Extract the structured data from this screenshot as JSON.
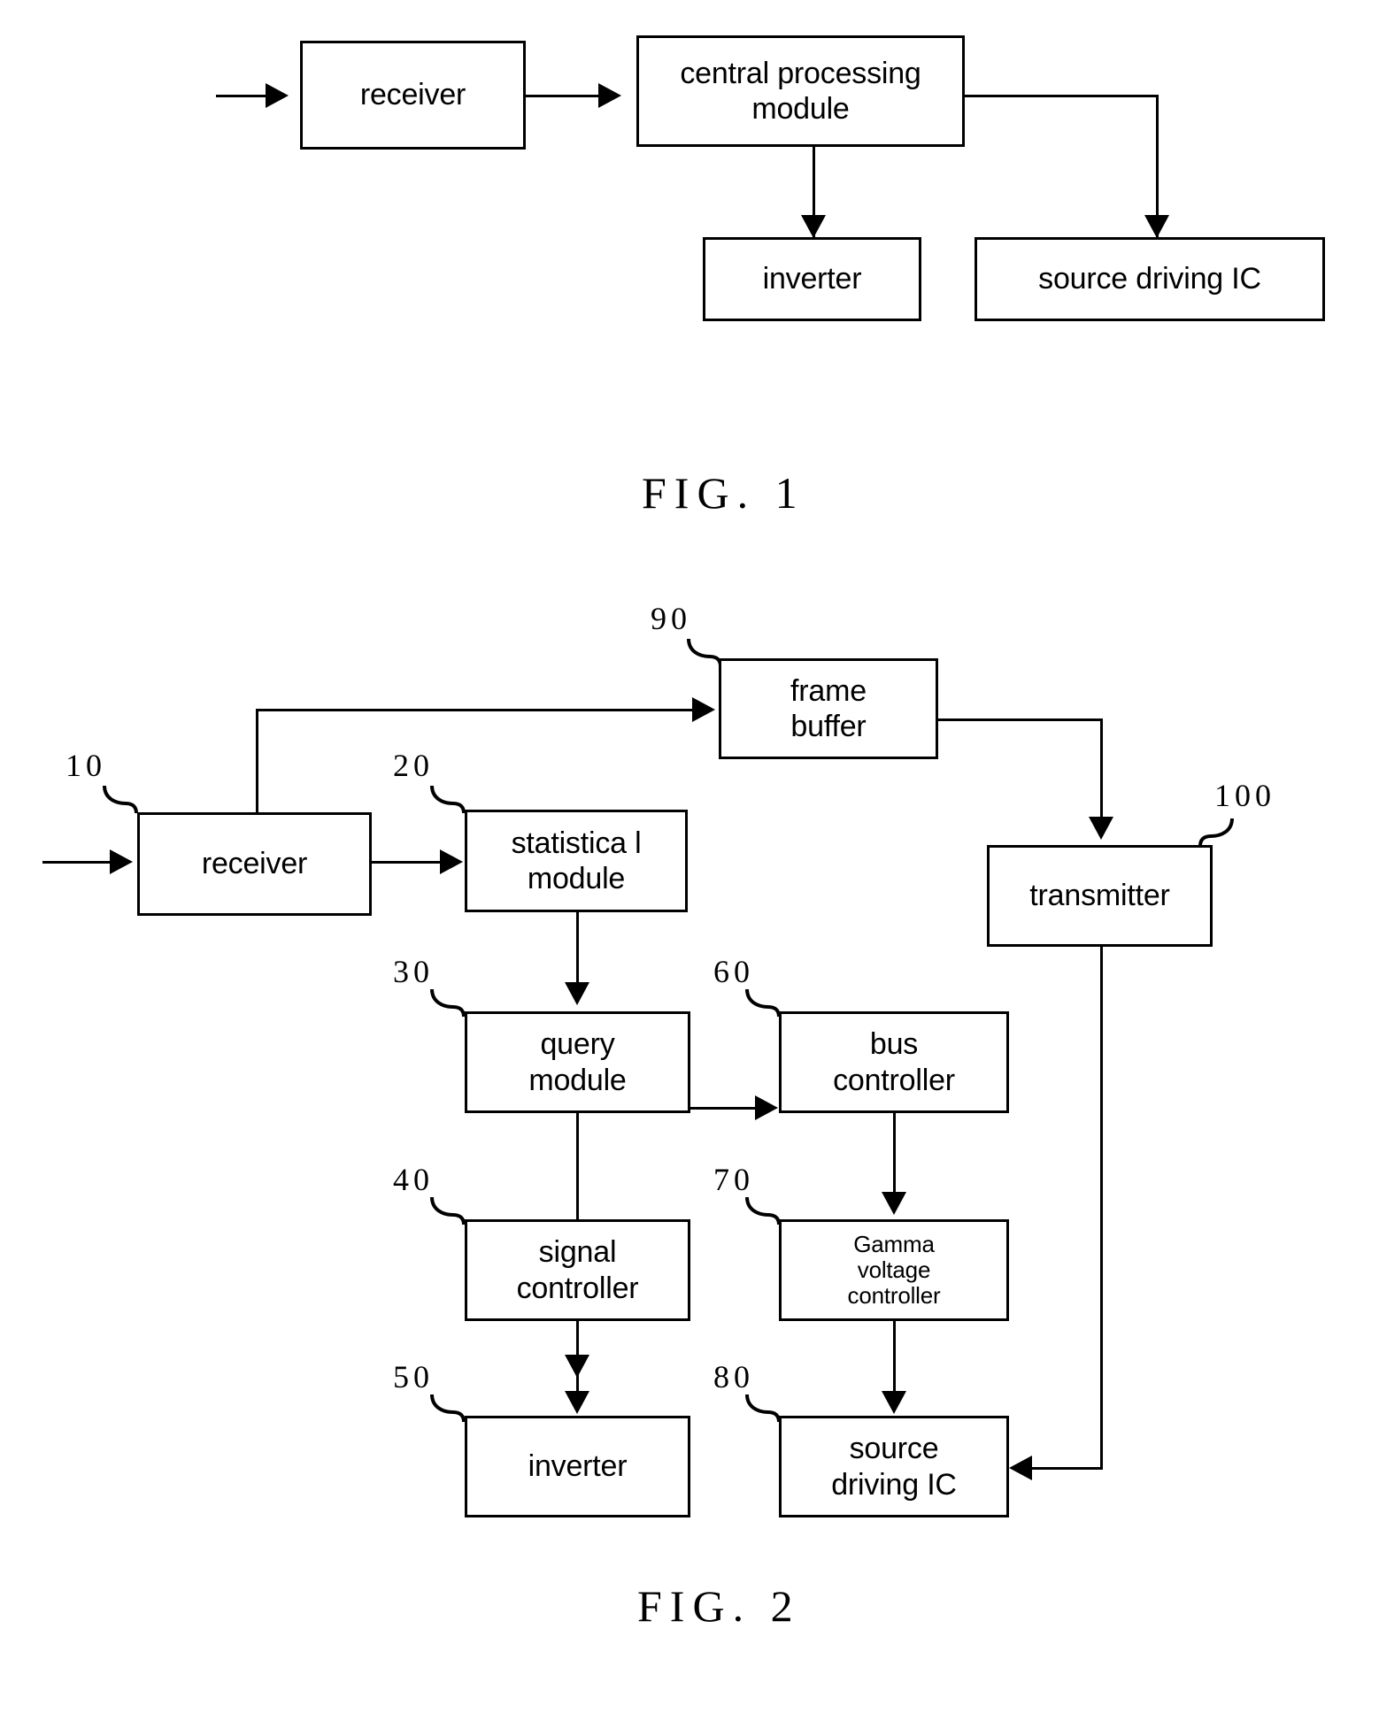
{
  "document": {
    "type": "patent-block-diagram-sheet",
    "line_color": "#000000",
    "background_color": "#ffffff"
  },
  "figures": [
    {
      "id": "fig1",
      "caption": "FIG.  1",
      "blocks": [
        {
          "id": "f1-receiver",
          "label": "receiver"
        },
        {
          "id": "f1-cpm",
          "label": "central processing module"
        },
        {
          "id": "f1-inverter",
          "label": "inverter"
        },
        {
          "id": "f1-source-driving-ic",
          "label": "source driving IC"
        }
      ],
      "connections": [
        {
          "from": "input",
          "to": "f1-receiver"
        },
        {
          "from": "f1-receiver",
          "to": "f1-cpm"
        },
        {
          "from": "f1-cpm",
          "to": "f1-inverter"
        },
        {
          "from": "f1-cpm",
          "to": "f1-source-driving-ic"
        }
      ]
    },
    {
      "id": "fig2",
      "caption": "FIG.  2",
      "blocks": [
        {
          "id": "f2-receiver",
          "ref": "10",
          "label": "receiver"
        },
        {
          "id": "f2-statistical",
          "ref": "20",
          "label": "statistica l module"
        },
        {
          "id": "f2-query",
          "ref": "30",
          "label": "query module"
        },
        {
          "id": "f2-signal",
          "ref": "40",
          "label": "signal controller"
        },
        {
          "id": "f2-inverter",
          "ref": "50",
          "label": "inverter"
        },
        {
          "id": "f2-bus",
          "ref": "60",
          "label": "bus controller"
        },
        {
          "id": "f2-gamma",
          "ref": "70",
          "label": "Gamma voltage controller"
        },
        {
          "id": "f2-source",
          "ref": "80",
          "label": "source driving IC"
        },
        {
          "id": "f2-frame-buffer",
          "ref": "90",
          "label": "frame buffer"
        },
        {
          "id": "f2-transmitter",
          "ref": "100",
          "label": "transmitter"
        }
      ],
      "connections": [
        {
          "from": "input",
          "to": "f2-receiver"
        },
        {
          "from": "f2-receiver",
          "to": "f2-statistical"
        },
        {
          "from": "f2-receiver",
          "to": "f2-frame-buffer"
        },
        {
          "from": "f2-statistical",
          "to": "f2-query"
        },
        {
          "from": "f2-query",
          "to": "f2-signal"
        },
        {
          "from": "f2-query",
          "to": "f2-bus"
        },
        {
          "from": "f2-signal",
          "to": "f2-inverter"
        },
        {
          "from": "f2-bus",
          "to": "f2-gamma"
        },
        {
          "from": "f2-gamma",
          "to": "f2-source"
        },
        {
          "from": "f2-frame-buffer",
          "to": "f2-transmitter"
        },
        {
          "from": "f2-transmitter",
          "to": "f2-source"
        }
      ]
    }
  ],
  "fig1": {
    "caption": "FIG.  1",
    "receiver": "receiver",
    "cpm_line1": "central processing",
    "cpm_line2": "module",
    "inverter": "inverter",
    "source_driving_ic": "source driving IC"
  },
  "fig2": {
    "caption": "FIG.  2",
    "receiver": "receiver",
    "statistical_line1": "statistica l",
    "statistical_line2": "module",
    "query_line1": "query",
    "query_line2": "module",
    "signal_line1": "signal",
    "signal_line2": "controller",
    "inverter": "inverter",
    "bus_line1": "bus",
    "bus_line2": "controller",
    "gamma_line1": "Gamma",
    "gamma_line2": "voltage",
    "gamma_line3": "controller",
    "source_line1": "source",
    "source_line2": "driving IC",
    "frame_line1": "frame",
    "frame_line2": "buffer",
    "transmitter": "transmitter",
    "refs": {
      "receiver": "10",
      "statistical": "20",
      "query": "30",
      "signal": "40",
      "inverter": "50",
      "bus": "60",
      "gamma": "70",
      "source": "80",
      "frame_buffer": "90",
      "transmitter": "100"
    }
  }
}
